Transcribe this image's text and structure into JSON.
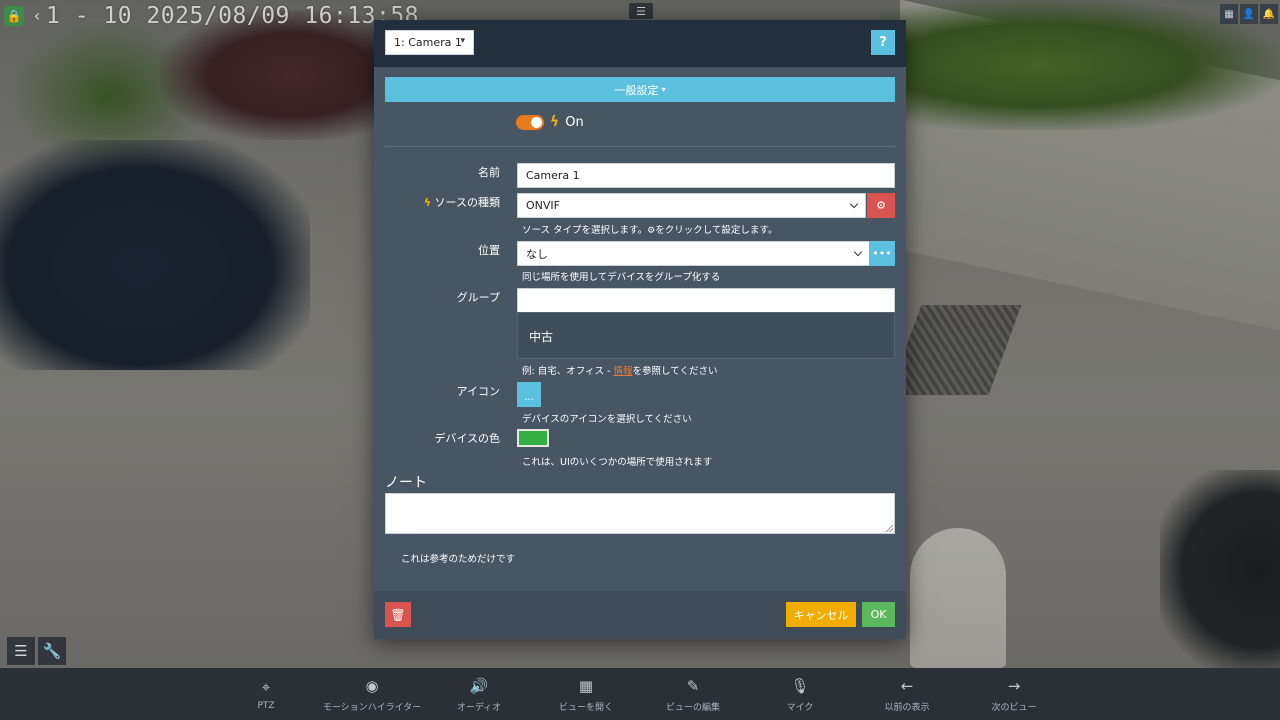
{
  "osd": {
    "timestamp": "1 - 10 2025/08/09 16:13:58",
    "back_glyph": "‹",
    "menu_glyph": "☰",
    "lock_glyph": "🔒",
    "top_right_icons": [
      "grid-icon",
      "user-icon",
      "bell-icon"
    ]
  },
  "modal": {
    "camera_select": "1: Camera 1",
    "help_label": "?",
    "section_title": "一般設定",
    "enabled_label": "On",
    "fields": {
      "name_label": "名前",
      "name_value": "Camera 1",
      "source_label": "ソースの種類",
      "source_value": "ONVIF",
      "source_help_1": "ソース タイプを選択します。",
      "source_help_2": "をクリックして設定します。",
      "location_label": "位置",
      "location_value": "なし",
      "location_help": "同じ場所を使用してデバイスをグループ化する",
      "group_label": "グループ",
      "group_value": "",
      "group_suggestion": "中古",
      "group_help_prefix": "例: 自宅、オフィス - ",
      "group_help_link": "情報",
      "group_help_suffix": "を参照してください",
      "icon_label": "アイコン",
      "icon_button": "...",
      "icon_help": "デバイスのアイコンを選択してください",
      "color_label": "デバイスの色",
      "color_value": "#35b045",
      "color_help": "これは、UIのいくつかの場所で使用されます"
    },
    "note_heading": "ノート",
    "note_value": "",
    "note_help": "これは参考のためだけです",
    "buttons": {
      "cancel": "キャンセル",
      "ok": "OK"
    }
  },
  "toolbar": [
    {
      "label": "PTZ",
      "icon": "crosshair-icon",
      "glyph": "⌖"
    },
    {
      "label": "モーションハイライター",
      "icon": "eye-icon",
      "glyph": "◉"
    },
    {
      "label": "オーディオ",
      "icon": "speaker-icon",
      "glyph": "🔊"
    },
    {
      "label": "ビューを開く",
      "icon": "grid-icon",
      "glyph": "▦"
    },
    {
      "label": "ビューの編集",
      "icon": "edit-icon",
      "glyph": "✎"
    },
    {
      "label": "マイク",
      "icon": "microphone-icon",
      "glyph": "🎙"
    },
    {
      "label": "以前の表示",
      "icon": "arrow-left-icon",
      "glyph": "←"
    },
    {
      "label": "次のビュー",
      "icon": "arrow-right-icon",
      "glyph": "→"
    }
  ],
  "colors": {
    "accent": "#5bc0de",
    "danger": "#d9534f",
    "warning": "#f0ad00",
    "success": "#5cb85c",
    "toggle": "#e8791f",
    "modal_bg": "#485664",
    "header_bg": "#232f3d"
  }
}
